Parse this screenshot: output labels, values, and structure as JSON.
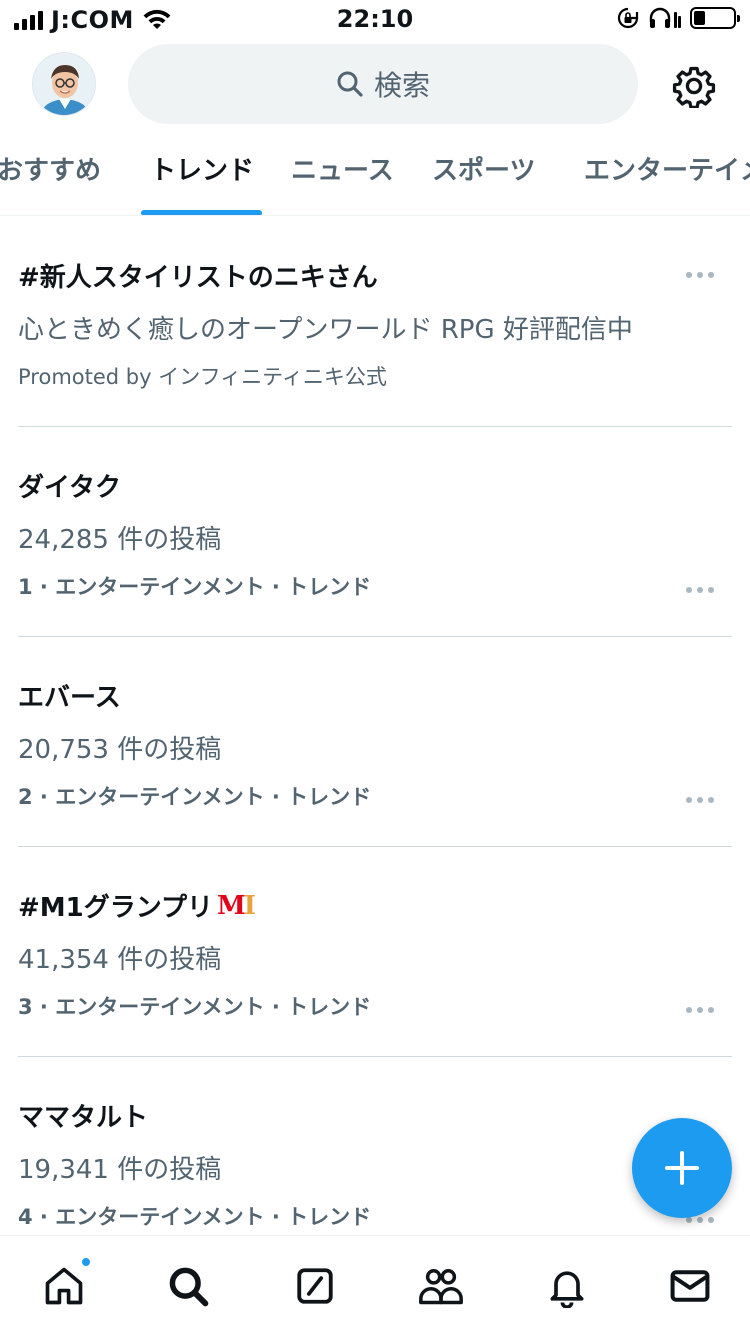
{
  "status_bar": {
    "carrier": "J:COM",
    "time": "22:10",
    "battery_level": 0.3
  },
  "header": {
    "search_placeholder": "検索",
    "avatar_icon": "user-avatar",
    "settings_icon": "gear-icon"
  },
  "tabs": [
    {
      "label": "おすすめ"
    },
    {
      "label": "トレンド",
      "active": true
    },
    {
      "label": "ニュース"
    },
    {
      "label": "スポーツ"
    },
    {
      "label": "エンターテイメ"
    }
  ],
  "trends": [
    {
      "title": "#新人スタイリストのニキさん",
      "subtitle": "心ときめく癒しのオープンワールド RPG 好評配信中",
      "meta": "Promoted by インフィニティニキ公式",
      "promoted": true
    },
    {
      "title": "ダイタク",
      "subtitle": "24,285 件の投稿",
      "meta": "1 · エンターテインメント · トレンド"
    },
    {
      "title": "エバース",
      "subtitle": "20,753 件の投稿",
      "meta": "2 · エンターテインメント · トレンド"
    },
    {
      "title": "#M1グランプリ",
      "subtitle": "41,354 件の投稿",
      "meta": "3 · エンターテインメント · トレンド",
      "has_logo": true
    },
    {
      "title": "ママタルト",
      "subtitle": "19,341 件の投稿",
      "meta": "4 · エンターテインメント · トレンド"
    }
  ],
  "fab": {
    "icon": "plus-icon"
  },
  "bottom_nav": [
    {
      "icon": "home-icon",
      "has_badge": true
    },
    {
      "icon": "search-icon"
    },
    {
      "icon": "grok-icon"
    },
    {
      "icon": "communities-icon"
    },
    {
      "icon": "bell-icon"
    },
    {
      "icon": "mail-icon"
    }
  ],
  "colors": {
    "accent": "#1d9bf0",
    "text_primary": "#0f1419",
    "text_secondary": "#536471",
    "divider": "#cfd9de"
  }
}
